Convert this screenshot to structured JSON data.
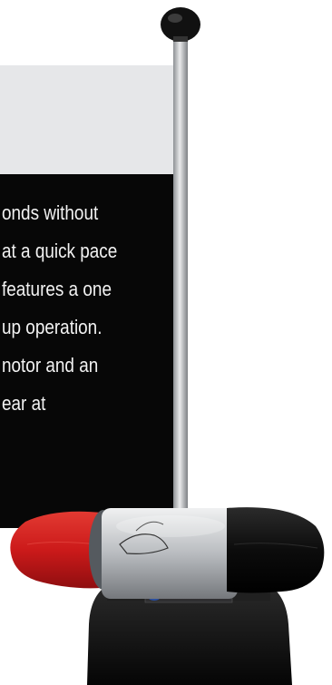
{
  "description": {
    "lines": [
      "onds without",
      "at a quick pace",
      "features a one",
      "up operation.",
      "notor and an",
      "ear at"
    ]
  },
  "product": {
    "name": "shoe shine machine with handle",
    "pole_color": "#a9abae",
    "red_brush_color": "#d81e1e",
    "black_brush_color": "#0b0b0b",
    "body_color": "#c8cacd",
    "base_color": "#151515"
  }
}
